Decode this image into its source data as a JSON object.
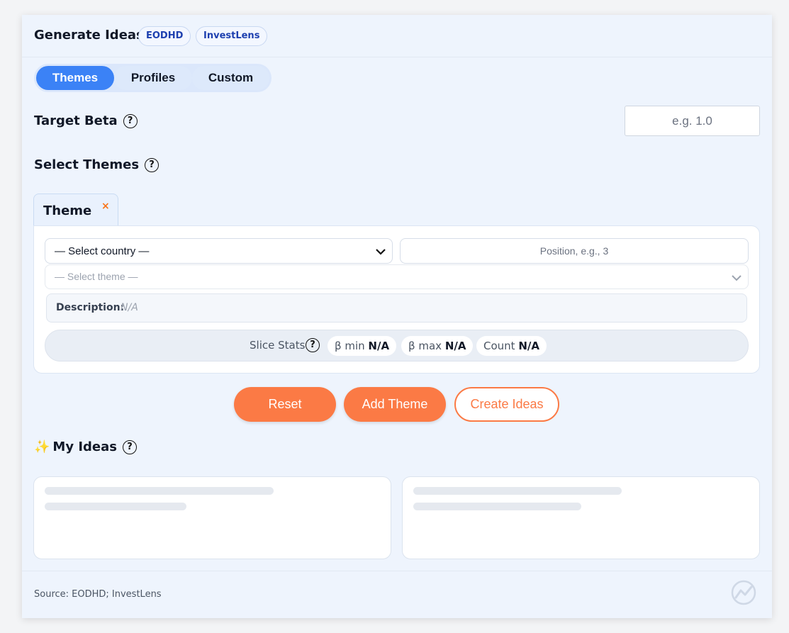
{
  "header": {
    "title": "Generate Ideas",
    "badges": [
      "EODHD",
      "InvestLens"
    ]
  },
  "tabs": {
    "items": [
      "Themes",
      "Profiles",
      "Custom"
    ],
    "active": "Themes"
  },
  "target_beta": {
    "label": "Target Beta",
    "placeholder": "e.g. 1.0"
  },
  "select_themes": {
    "label": "Select Themes"
  },
  "theme_tab": {
    "label": "Theme",
    "close": "×"
  },
  "theme_form": {
    "country_select": "— Select country —",
    "position_placeholder": "Position, e.g., 3",
    "theme_select": "— Select theme —",
    "description_label": "Description:",
    "description_value": "N/A",
    "slice_stats_label": "Slice Stats",
    "beta_min_label": "β min",
    "beta_min_value": "N/A",
    "beta_max_label": "β max",
    "beta_max_value": "N/A",
    "count_label": "Count",
    "count_value": "N/A"
  },
  "actions": {
    "reset": "Reset",
    "add_theme": "Add Theme",
    "create_ideas": "Create Ideas"
  },
  "my_ideas": {
    "emoji": "✨",
    "label": "My Ideas"
  },
  "footer": {
    "source": "Source: EODHD; InvestLens"
  },
  "colors": {
    "accent_blue": "#3b82f6",
    "accent_orange": "#fb7a45",
    "card_background": "#eef4fd"
  },
  "icons": [
    "help-icon",
    "chevron-down-icon",
    "close-icon",
    "sparkles-icon",
    "logo-icon"
  ]
}
